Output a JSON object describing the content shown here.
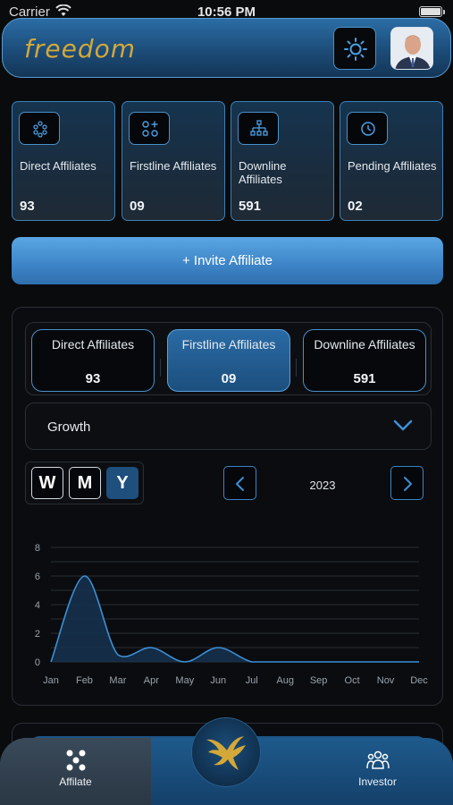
{
  "status_bar": {
    "carrier": "Carrier",
    "time": "10:56 PM"
  },
  "header": {
    "logo_text": "freedom",
    "theme_icon": "sun-icon",
    "avatar_icon": "user-photo"
  },
  "stats": [
    {
      "label": "Direct Affiliates",
      "value": "93",
      "icon": "network-dots-icon"
    },
    {
      "label": "Firstline Affiliates",
      "value": "09",
      "icon": "grid-plus-icon"
    },
    {
      "label": "Downline Affiliates",
      "value": "591",
      "icon": "hierarchy-icon"
    },
    {
      "label": "Pending Affiliates",
      "value": "02",
      "icon": "clock-icon"
    }
  ],
  "invite_button": "+ Invite Affiliate",
  "segments": [
    {
      "label": "Direct Affiliates",
      "value": "93",
      "active": false
    },
    {
      "label": "Firstline Affiliates",
      "value": "09",
      "active": true
    },
    {
      "label": "Downline Affiliates",
      "value": "591",
      "active": false
    }
  ],
  "dropdown": {
    "selected": "Growth"
  },
  "period_buttons": [
    {
      "label": "W",
      "active": false
    },
    {
      "label": "M",
      "active": false
    },
    {
      "label": "Y",
      "active": true
    }
  ],
  "year": "2023",
  "chart_data": {
    "type": "area",
    "categories": [
      "Jan",
      "Feb",
      "Mar",
      "Apr",
      "May",
      "Jun",
      "Jul",
      "Aug",
      "Sep",
      "Oct",
      "Nov",
      "Dec"
    ],
    "values": [
      0,
      6,
      0.5,
      1,
      0,
      1,
      0,
      0,
      0,
      0,
      0,
      0
    ],
    "ylim": [
      0,
      8
    ],
    "yticks": [
      0,
      2,
      4,
      6,
      8
    ],
    "grid": true,
    "line_color": "#3d8fd6",
    "fill_color": "#16334f"
  },
  "tabs": [
    {
      "label": "Affilate",
      "icon": "dots-cluster-icon",
      "active": true
    },
    {
      "label": "Investor",
      "icon": "people-group-icon",
      "active": false
    }
  ],
  "colors": {
    "accent": "#3c86c6",
    "gold": "#d4a838",
    "background": "#0a0b0d"
  }
}
